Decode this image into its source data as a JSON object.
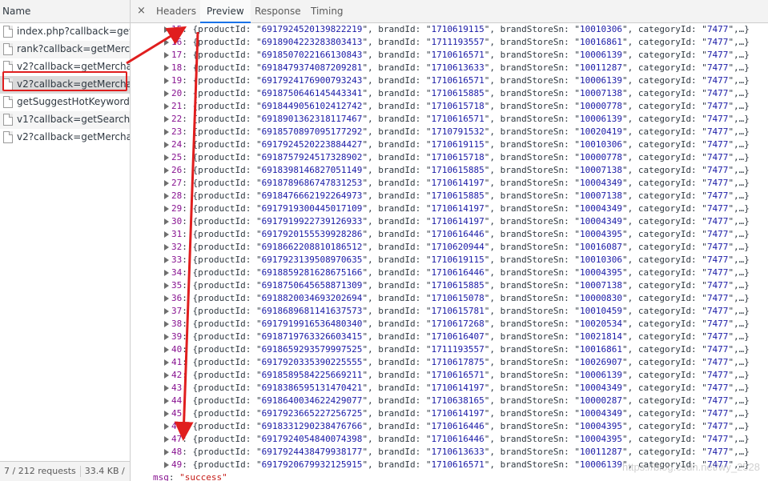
{
  "left_panel": {
    "header": "Name",
    "requests": [
      {
        "name": "index.php?callback=get..."
      },
      {
        "name": "rank?callback=getMerc..."
      },
      {
        "name": "v2?callback=getMercha..."
      },
      {
        "name": "v2?callback=getMercha..."
      },
      {
        "name": "getSuggestHotKeyword..."
      },
      {
        "name": "v1?callback=getSearch..."
      },
      {
        "name": "v2?callback=getMercha..."
      }
    ],
    "footer": {
      "requests": "7 / 212 requests",
      "size": "33.4 KB /"
    }
  },
  "tabs": {
    "close": "×",
    "headers": "Headers",
    "preview": "Preview",
    "response": "Response",
    "timing": "Timing"
  },
  "preview": {
    "rows": [
      {
        "idx": "15",
        "productId": "6917924520139822219",
        "brandId": "1710619115",
        "brandStoreSn": "10010306",
        "categoryId": "7477"
      },
      {
        "idx": "16",
        "productId": "6918904223283803413",
        "brandId": "1711193557",
        "brandStoreSn": "10016861",
        "categoryId": "7477"
      },
      {
        "idx": "17",
        "productId": "6918507022166130843",
        "brandId": "1710616571",
        "brandStoreSn": "10006139",
        "categoryId": "7477"
      },
      {
        "idx": "18",
        "productId": "6918479374087209281",
        "brandId": "1710613633",
        "brandStoreSn": "10011287",
        "categoryId": "7477"
      },
      {
        "idx": "19",
        "productId": "6917924176900793243",
        "brandId": "1710616571",
        "brandStoreSn": "10006139",
        "categoryId": "7477"
      },
      {
        "idx": "20",
        "productId": "6918750646145443341",
        "brandId": "1710615885",
        "brandStoreSn": "10007138",
        "categoryId": "7477"
      },
      {
        "idx": "21",
        "productId": "6918449056102412742",
        "brandId": "1710615718",
        "brandStoreSn": "10000778",
        "categoryId": "7477"
      },
      {
        "idx": "22",
        "productId": "6918901362318117467",
        "brandId": "1710616571",
        "brandStoreSn": "10006139",
        "categoryId": "7477"
      },
      {
        "idx": "23",
        "productId": "6918570897095177292",
        "brandId": "1710791532",
        "brandStoreSn": "10020419",
        "categoryId": "7477"
      },
      {
        "idx": "24",
        "productId": "6917924520223884427",
        "brandId": "1710619115",
        "brandStoreSn": "10010306",
        "categoryId": "7477"
      },
      {
        "idx": "25",
        "productId": "6918757924517328902",
        "brandId": "1710615718",
        "brandStoreSn": "10000778",
        "categoryId": "7477"
      },
      {
        "idx": "26",
        "productId": "6918398146827051149",
        "brandId": "1710615885",
        "brandStoreSn": "10007138",
        "categoryId": "7477"
      },
      {
        "idx": "27",
        "productId": "6918789686747831253",
        "brandId": "1710614197",
        "brandStoreSn": "10004349",
        "categoryId": "7477"
      },
      {
        "idx": "28",
        "productId": "6918476662192264973",
        "brandId": "1710615885",
        "brandStoreSn": "10007138",
        "categoryId": "7477"
      },
      {
        "idx": "29",
        "productId": "6917919300445017109",
        "brandId": "1710614197",
        "brandStoreSn": "10004349",
        "categoryId": "7477"
      },
      {
        "idx": "30",
        "productId": "6917919922739126933",
        "brandId": "1710614197",
        "brandStoreSn": "10004349",
        "categoryId": "7477"
      },
      {
        "idx": "31",
        "productId": "6917920155539928286",
        "brandId": "1710616446",
        "brandStoreSn": "10004395",
        "categoryId": "7477"
      },
      {
        "idx": "32",
        "productId": "6918662208810186512",
        "brandId": "1710620944",
        "brandStoreSn": "10016087",
        "categoryId": "7477"
      },
      {
        "idx": "33",
        "productId": "6917923139508970635",
        "brandId": "1710619115",
        "brandStoreSn": "10010306",
        "categoryId": "7477"
      },
      {
        "idx": "34",
        "productId": "6918859281628675166",
        "brandId": "1710616446",
        "brandStoreSn": "10004395",
        "categoryId": "7477"
      },
      {
        "idx": "35",
        "productId": "6918750645658871309",
        "brandId": "1710615885",
        "brandStoreSn": "10007138",
        "categoryId": "7477"
      },
      {
        "idx": "36",
        "productId": "6918820034693202694",
        "brandId": "1710615078",
        "brandStoreSn": "10000830",
        "categoryId": "7477"
      },
      {
        "idx": "37",
        "productId": "6918689681141637573",
        "brandId": "1710615781",
        "brandStoreSn": "10010459",
        "categoryId": "7477"
      },
      {
        "idx": "38",
        "productId": "6917919916536480340",
        "brandId": "1710617268",
        "brandStoreSn": "10020534",
        "categoryId": "7477"
      },
      {
        "idx": "39",
        "productId": "6918719763326603415",
        "brandId": "1710616407",
        "brandStoreSn": "10021814",
        "categoryId": "7477"
      },
      {
        "idx": "40",
        "productId": "6918659293579997525",
        "brandId": "1711193557",
        "brandStoreSn": "10016861",
        "categoryId": "7477"
      },
      {
        "idx": "41",
        "productId": "6917920335390225555",
        "brandId": "1710617875",
        "brandStoreSn": "10026907",
        "categoryId": "7477"
      },
      {
        "idx": "42",
        "productId": "6918589584225669211",
        "brandId": "1710616571",
        "brandStoreSn": "10006139",
        "categoryId": "7477"
      },
      {
        "idx": "43",
        "productId": "6918386595131470421",
        "brandId": "1710614197",
        "brandStoreSn": "10004349",
        "categoryId": "7477"
      },
      {
        "idx": "44",
        "productId": "6918640034622429077",
        "brandId": "1710638165",
        "brandStoreSn": "10000287",
        "categoryId": "7477"
      },
      {
        "idx": "45",
        "productId": "6917923665227256725",
        "brandId": "1710614197",
        "brandStoreSn": "10004349",
        "categoryId": "7477"
      },
      {
        "idx": "46",
        "productId": "6918331290238476766",
        "brandId": "1710616446",
        "brandStoreSn": "10004395",
        "categoryId": "7477"
      },
      {
        "idx": "47",
        "productId": "6917924054840074398",
        "brandId": "1710616446",
        "brandStoreSn": "10004395",
        "categoryId": "7477"
      },
      {
        "idx": "48",
        "productId": "6917924438479938177",
        "brandId": "1710613633",
        "brandStoreSn": "10011287",
        "categoryId": "7477"
      },
      {
        "idx": "49",
        "productId": "6917920679932125915",
        "brandId": "1710616571",
        "brandStoreSn": "10006139",
        "categoryId": "7477"
      }
    ],
    "msg_key": "msg",
    "msg_value": "\"success\""
  },
  "watermark": "https://blog.csdn.net/wy_2528",
  "colors": {
    "annotation_red": "#e01e1e",
    "active_tab": "#1a73e8"
  }
}
